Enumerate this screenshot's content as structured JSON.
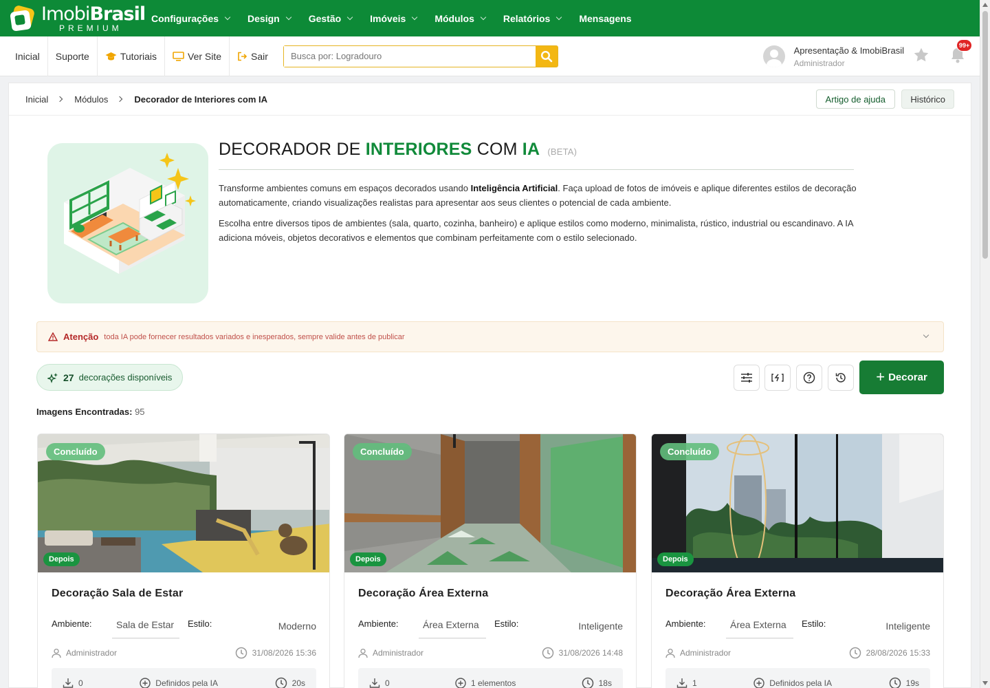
{
  "brand": {
    "name_light": "Imobi",
    "name_bold": "Brasil",
    "tier": "PREMIUM",
    "accent": "#0d8a37"
  },
  "topmenu": [
    {
      "label": "Configurações",
      "dropdown": true
    },
    {
      "label": "Design",
      "dropdown": true
    },
    {
      "label": "Gestão",
      "dropdown": true
    },
    {
      "label": "Imóveis",
      "dropdown": true
    },
    {
      "label": "Módulos",
      "dropdown": true
    },
    {
      "label": "Relatórios",
      "dropdown": true
    },
    {
      "label": "Mensagens",
      "dropdown": false
    }
  ],
  "subbar": {
    "inicial": "Inicial",
    "suporte": "Suporte",
    "tutoriais": "Tutoriais",
    "ver_site": "Ver Site",
    "sair": "Sair",
    "search_placeholder": "Busca por: Logradouro"
  },
  "user": {
    "name": "Apresentação & ImobiBrasil",
    "role": "Administrador",
    "notifications": "99+"
  },
  "breadcrumb": {
    "home": "Inicial",
    "modules": "Módulos",
    "current": "Decorador de Interiores com IA"
  },
  "actions": {
    "help": "Artigo de ajuda",
    "history": "Histórico"
  },
  "hero": {
    "title_pre": "DECORADOR DE",
    "title_green": "INTERIORES",
    "title_mid": "COM",
    "title_green2": "IA",
    "beta": "(BETA)",
    "p1_a": "Transforme ambientes comuns em espaços decorados usando ",
    "p1_bold": "Inteligência Artificial",
    "p1_b": ". Faça upload de fotos de imóveis e aplique diferentes estilos de decoração automaticamente, criando visualizações realistas para apresentar aos seus clientes o potencial de cada ambiente.",
    "p2": "Escolha entre diversos tipos de ambientes (sala, quarto, cozinha, banheiro) e aplique estilos como moderno, minimalista, rústico, industrial ou escandinavo. A IA adiciona móveis, objetos decorativos e elementos que combinam perfeitamente com o estilo selecionado."
  },
  "alert": {
    "label": "Atenção",
    "message": "toda IA pode fornecer resultados variados e inesperados, sempre valide antes de publicar"
  },
  "credits": {
    "count": "27",
    "label": "decorações disponíveis"
  },
  "decorar_label": "Decorar",
  "found": {
    "label": "Imagens Encontradas:",
    "count": "95"
  },
  "labels": {
    "ambiente": "Ambiente:",
    "estilo": "Estilo:",
    "status": "Concluído",
    "after": "Depois"
  },
  "cards": [
    {
      "title": "Decoração Sala de Estar",
      "ambiente": "Sala de Estar",
      "estilo": "Moderno",
      "author": "Administrador",
      "date": "31/08/2026 15:36",
      "downloads": "0",
      "elements": "Definidos pela IA",
      "time": "20s"
    },
    {
      "title": "Decoração Área Externa",
      "ambiente": "Área Externa",
      "estilo": "Inteligente",
      "author": "Administrador",
      "date": "31/08/2026 14:48",
      "downloads": "0",
      "elements": "1 elementos",
      "time": "18s"
    },
    {
      "title": "Decoração Área Externa",
      "ambiente": "Área Externa",
      "estilo": "Inteligente",
      "author": "Administrador",
      "date": "28/08/2026 15:33",
      "downloads": "1",
      "elements": "Definidos pela IA",
      "time": "19s"
    }
  ]
}
